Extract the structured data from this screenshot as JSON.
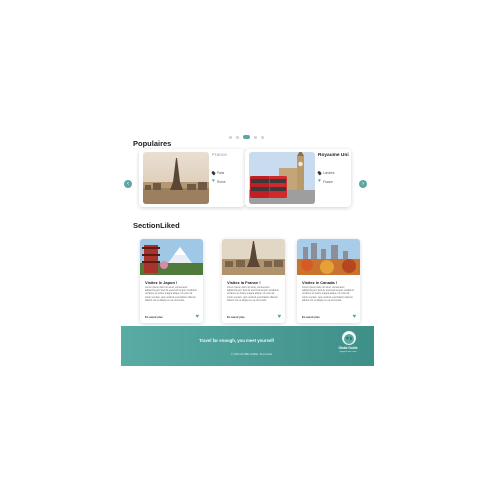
{
  "carousel": {
    "dot_count": 5,
    "active_index": 2
  },
  "populaires": {
    "title": "Populaires",
    "cards": [
      {
        "name": "France",
        "location": "Paris",
        "likes": "Rome"
      },
      {
        "name": "Royaume Uni",
        "location": "Londres",
        "likes": "France"
      }
    ]
  },
  "liked": {
    "title": "SectionLiked",
    "cards": [
      {
        "title": "Visitez le Japon !",
        "text": "Lorem ipsum dolor sit amet, consectetur adipiscing elit. Sed do eiusmod tempor incididunt ut labore et dolore magna aliqua. Ut enim ad minim veniam, quis nostrud exercitation ullamco laboris nisi ut aliquip ex ea commodo.",
        "more": "En savoir plus"
      },
      {
        "title": "Visitez la France !",
        "text": "Lorem ipsum dolor sit amet, consectetur adipiscing elit. Sed do eiusmod tempor incididunt ut labore et dolore magna aliqua. Ut enim ad minim veniam, quis nostrud exercitation ullamco laboris nisi ut aliquip ex ea commodo.",
        "more": "En savoir plus"
      },
      {
        "title": "Visitez le Canada !",
        "text": "Lorem ipsum dolor sit amet, consectetur adipiscing elit. Sed do eiusmod tempor incididunt ut labore et dolore magna aliqua. Ut enim ad minim veniam, quis nostrud exercitation ullamco laboris nisi ut aliquip ex ea commodo.",
        "more": "En savoir plus"
      }
    ]
  },
  "footer": {
    "slogan": "Travel far enough, you meet yourself",
    "copyright": "© 2024 GLOBE GUIDE. Tous droits",
    "logo_name": "Globe Guide",
    "logo_tagline": "voyagez avec nous"
  },
  "colors": {
    "accent": "#5aa8a2",
    "footer_start": "#58aca4",
    "footer_end": "#3f8f89"
  },
  "icons": {
    "prev": "chevron-left-icon",
    "next": "chevron-right-icon",
    "location": "pin-icon",
    "like": "heart-icon"
  }
}
